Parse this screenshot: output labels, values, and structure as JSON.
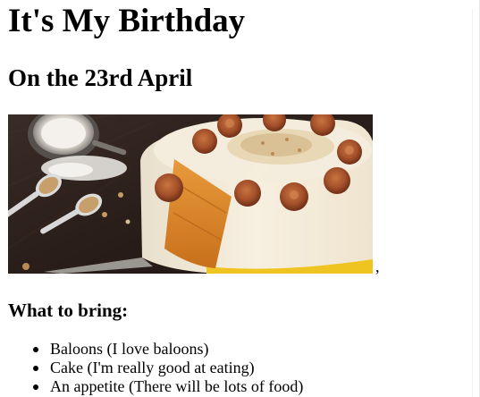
{
  "heading": "It's My Birthday",
  "date_heading": "On the 23rd April",
  "photo": {
    "alt": "birthday cake",
    "trailing_text": ","
  },
  "bring_heading": "What to bring:",
  "bring_items": [
    "Baloons (I love baloons)",
    "Cake (I'm really good at eating)",
    "An appetite (There will be lots of food)"
  ],
  "colors": {
    "background": "#ffffff",
    "text": "#000000",
    "frosting": "#f3ead8",
    "sponge": "#e08a2a",
    "caramel": "#a4502a",
    "table": "#2a1e1a"
  }
}
